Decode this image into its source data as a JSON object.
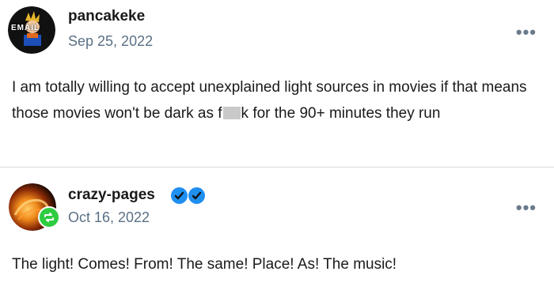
{
  "posts": [
    {
      "username": "pancakeke",
      "date": "Sep 25, 2022",
      "avatar_text": "EMAIL",
      "body_before": "I am totally willing to accept unexplained light sources in movies if that means those movies won't be dark as f",
      "body_after": "k for the 90+ minutes they run",
      "more_label": "•••"
    },
    {
      "username": "crazy-pages",
      "date": "Oct 16, 2022",
      "body": "The light! Comes! From! The same! Place! As! The music!",
      "more_label": "•••"
    }
  ],
  "colors": {
    "verified": "#1f8ff0",
    "reblog": "#2ecc40",
    "date": "#5b7086"
  },
  "icons": [
    "more-icon",
    "verified-icon",
    "reblog-icon"
  ]
}
